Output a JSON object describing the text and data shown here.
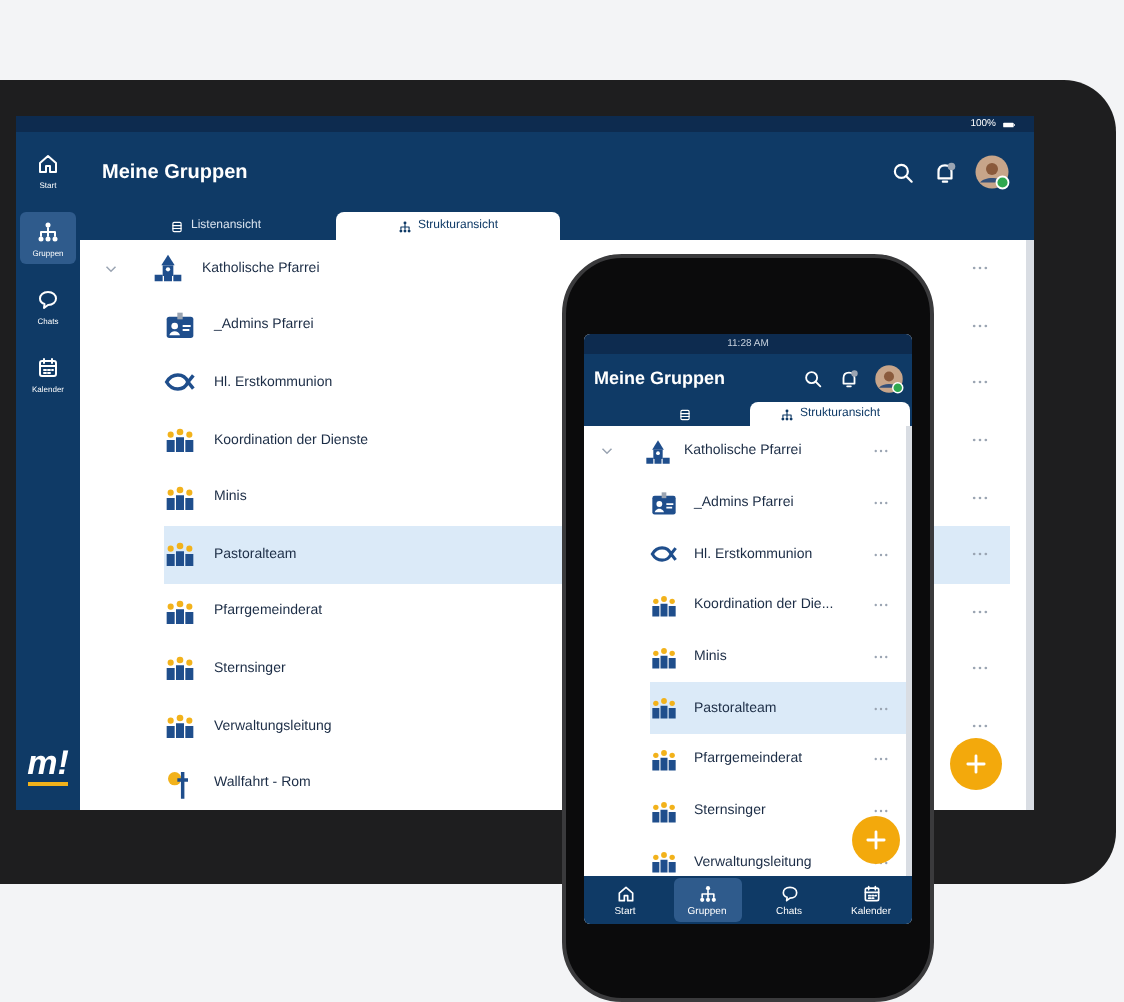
{
  "tablet": {
    "status_bar": {
      "battery": "100%"
    },
    "sidebar": [
      {
        "kind": "home",
        "label": "Start",
        "selected": false
      },
      {
        "kind": "hierarchy",
        "label": "Gruppen",
        "selected": true
      },
      {
        "kind": "chat",
        "label": "Chats",
        "selected": false
      },
      {
        "kind": "calendar",
        "label": "Kalender",
        "selected": false
      }
    ],
    "logo": "m!",
    "header": {
      "title": "Meine Gruppen"
    },
    "tabs": [
      {
        "kind": "list",
        "label": "Listenansicht",
        "selected": false
      },
      {
        "kind": "hierarchy",
        "label": "Strukturansicht",
        "selected": true
      }
    ],
    "tree": {
      "label": "Katholische Pfarrei",
      "kind": "church",
      "expanded": true,
      "selected": false,
      "children": [
        {
          "label": "_Admins Pfarrei",
          "kind": "id-card",
          "selected": false
        },
        {
          "label": "Hl. Erstkommunion",
          "kind": "fish",
          "selected": false
        },
        {
          "label": "Koordination der Dienste",
          "kind": "people",
          "selected": false
        },
        {
          "label": "Minis",
          "kind": "people",
          "selected": false
        },
        {
          "label": "Pastoralteam",
          "kind": "people",
          "selected": true
        },
        {
          "label": "Pfarrgemeinderat",
          "kind": "people",
          "selected": false
        },
        {
          "label": "Sternsinger",
          "kind": "people",
          "selected": false
        },
        {
          "label": "Verwaltungsleitung",
          "kind": "people",
          "selected": false
        },
        {
          "label": "Wallfahrt - Rom",
          "kind": "sun-cross",
          "selected": false
        }
      ]
    }
  },
  "phone": {
    "status_bar": {
      "time": "11:28 AM"
    },
    "header": {
      "title": "Meine Gruppen"
    },
    "tabs": [
      {
        "kind": "list",
        "selected": false
      },
      {
        "kind": "hierarchy",
        "label": "Strukturansicht",
        "selected": true
      }
    ],
    "tree": {
      "label": "Katholische Pfarrei",
      "kind": "church",
      "expanded": true,
      "selected": false,
      "children": [
        {
          "label": "_Admins Pfarrei",
          "kind": "id-card",
          "selected": false
        },
        {
          "label": "Hl. Erstkommunion",
          "kind": "fish",
          "selected": false
        },
        {
          "label": "Koordination der Die...",
          "kind": "people",
          "selected": false
        },
        {
          "label": "Minis",
          "kind": "people",
          "selected": false
        },
        {
          "label": "Pastoralteam",
          "kind": "people",
          "selected": true
        },
        {
          "label": "Pfarrgemeinderat",
          "kind": "people",
          "selected": false
        },
        {
          "label": "Sternsinger",
          "kind": "people",
          "selected": false
        },
        {
          "label": "Verwaltungsleitung",
          "kind": "people",
          "selected": false
        }
      ]
    },
    "nav": [
      {
        "kind": "home",
        "label": "Start",
        "selected": false
      },
      {
        "kind": "hierarchy",
        "label": "Gruppen",
        "selected": true
      },
      {
        "kind": "chat",
        "label": "Chats",
        "selected": false
      },
      {
        "kind": "calendar",
        "label": "Kalender",
        "selected": false
      }
    ]
  }
}
